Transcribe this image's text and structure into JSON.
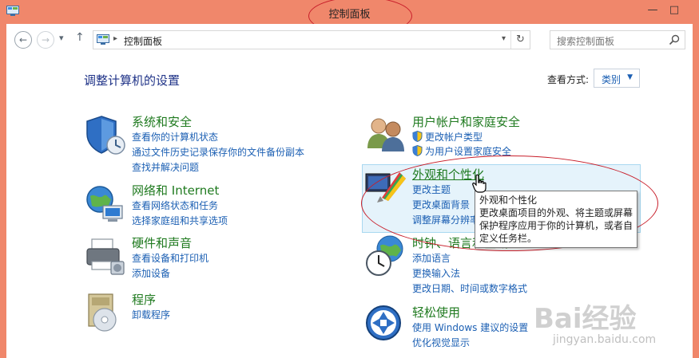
{
  "window": {
    "title": "控制面板",
    "minimize_glyph": "—",
    "maximize_glyph": "□"
  },
  "nav": {
    "back_glyph": "←",
    "forward_glyph": "→",
    "recent_glyph": "▾",
    "up_glyph": "↑",
    "address_sep": "▸",
    "address_text": "控制面板",
    "address_drop": "▾",
    "refresh_glyph": "↻",
    "search_placeholder": "搜索控制面板"
  },
  "main": {
    "heading": "调整计算机的设置",
    "view_by_label": "查看方式:",
    "view_by_value": "类别",
    "view_by_arrow": "▼"
  },
  "categories": {
    "system": {
      "title": "系统和安全",
      "links": [
        "查看你的计算机状态",
        "通过文件历史记录保存你的文件备份副本",
        "查找并解决问题"
      ]
    },
    "network": {
      "title": "网络和 Internet",
      "links": [
        "查看网络状态和任务",
        "选择家庭组和共享选项"
      ]
    },
    "hardware": {
      "title": "硬件和声音",
      "links": [
        "查看设备和打印机",
        "添加设备"
      ]
    },
    "programs": {
      "title": "程序",
      "links": [
        "卸载程序"
      ]
    },
    "users": {
      "title": "用户帐户和家庭安全",
      "links": [
        "更改帐户类型",
        "为用户设置家庭安全"
      ]
    },
    "appearance": {
      "title": "外观和个性化",
      "links": [
        "更改主题",
        "更改桌面背景",
        "调整屏幕分辨率"
      ]
    },
    "clock": {
      "title": "时钟、语言和区域",
      "links": [
        "添加语言",
        "更换输入法",
        "更改日期、时间或数字格式"
      ]
    },
    "ease": {
      "title": "轻松使用",
      "links": [
        "使用 Windows 建议的设置",
        "优化视觉显示"
      ]
    }
  },
  "tooltip": {
    "title": "外观和个性化",
    "body": "更改桌面项目的外观、将主题或屏幕保护程序应用于你的计算机，或者自定义任务栏。"
  },
  "watermark": {
    "main": "Bai经验",
    "sub": "jingyan.baidu.com"
  },
  "colors": {
    "titlebar": "#f0876b",
    "link": "#1b5fb3",
    "category_title": "#1f7a1f",
    "heading": "#1e3287",
    "annotation": "#c81e2a"
  }
}
